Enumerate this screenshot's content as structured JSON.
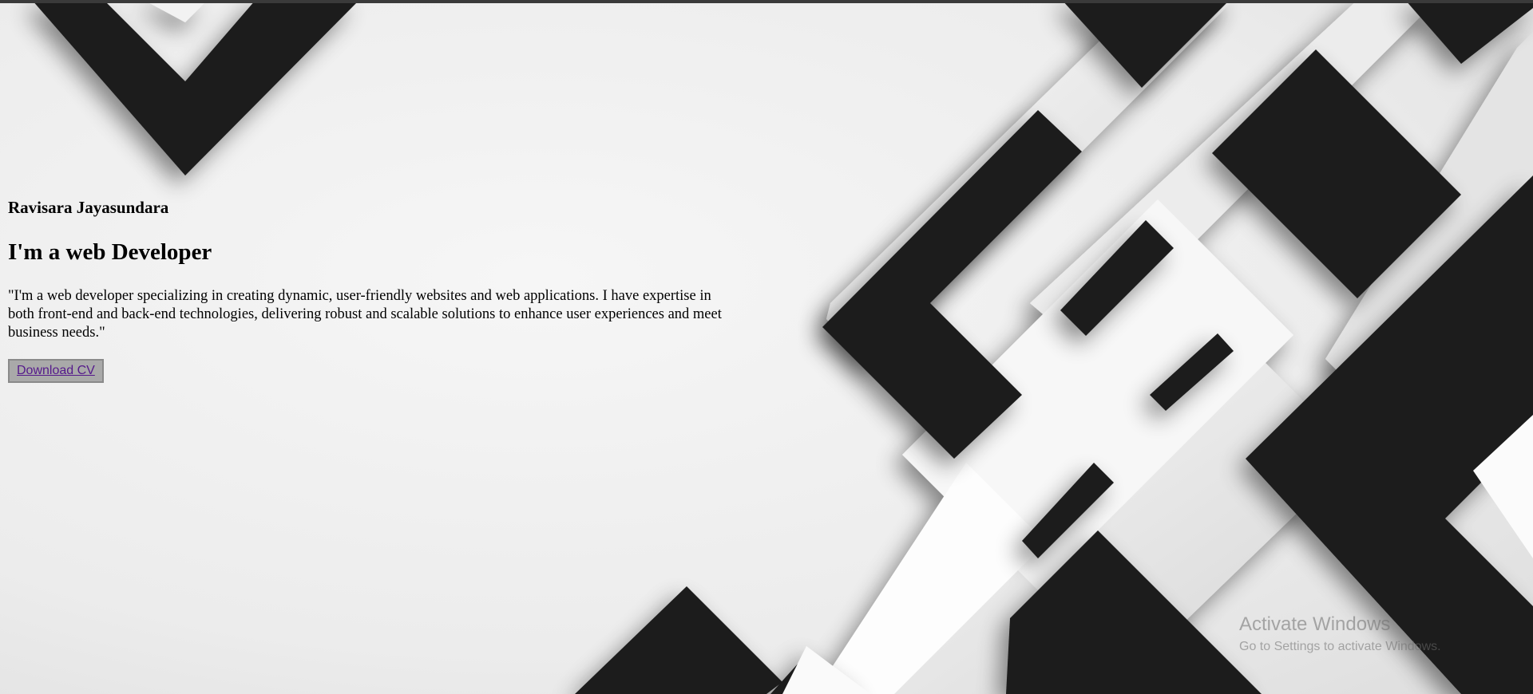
{
  "profile": {
    "name": "Ravisara Jayasundara",
    "headline": "I'm a web Developer",
    "bio": "\"I'm a web developer specializing in creating dynamic, user-friendly websites and web applications. I have expertise in both front-end and back-end technologies, delivering robust and scalable solutions to enhance user experiences and meet business needs.\"",
    "download_label": "Download CV"
  },
  "watermark": {
    "title": "Activate Windows",
    "subtitle": "Go to Settings to activate Windows."
  },
  "colors": {
    "background": "#eeeeee",
    "shape_dark": "#1b1b1b",
    "shape_light": "#ffffff",
    "button_bg": "#a9a9a9",
    "link": "#551a8b"
  }
}
